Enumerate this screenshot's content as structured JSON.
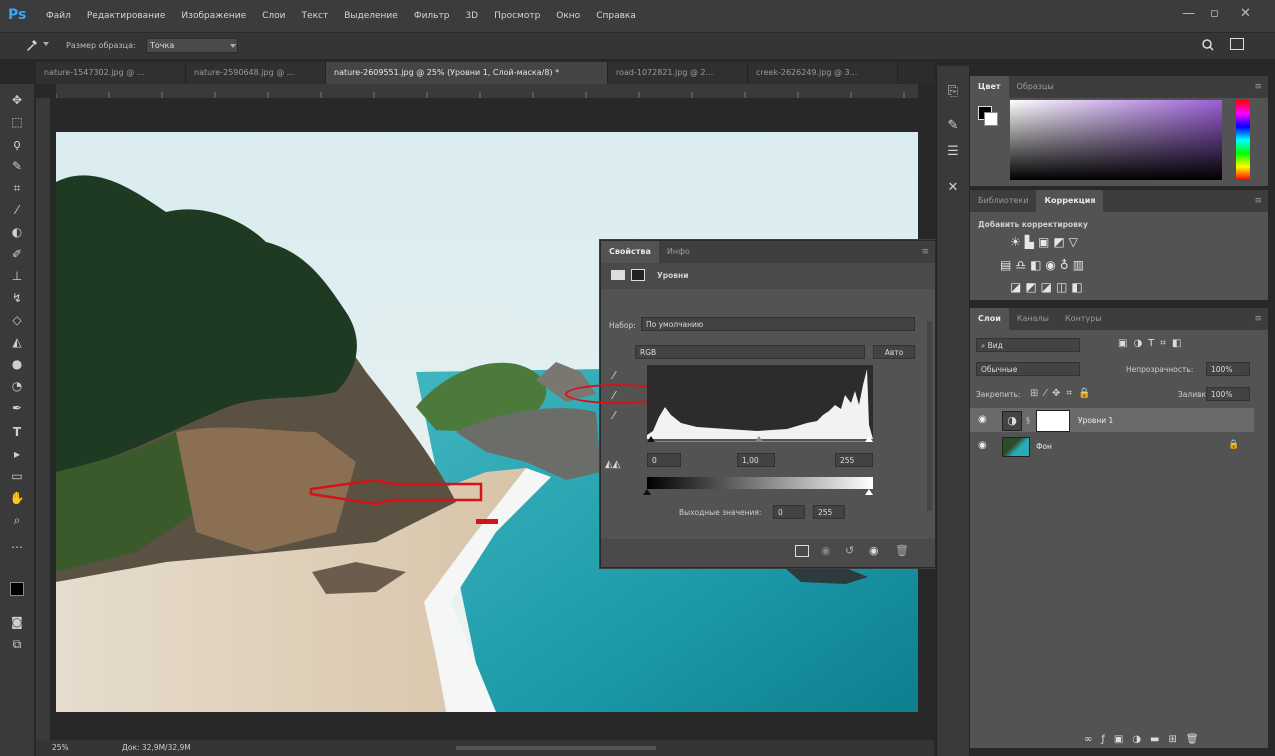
{
  "app": {
    "logo": "Ps",
    "menu": [
      "Файл",
      "Редактирование",
      "Изображение",
      "Слои",
      "Текст",
      "Выделение",
      "Фильтр",
      "3D",
      "Просмотр",
      "Окно",
      "Справка"
    ],
    "window_controls": [
      "—",
      "▫",
      "✕"
    ]
  },
  "options": {
    "tool_icon": "eyedropper-icon",
    "sample_label": "Размер образца:",
    "sample_value": "Точка"
  },
  "tabs": [
    {
      "label": "nature-1547302.jpg @ ...",
      "close": "×"
    },
    {
      "label": "nature-2590648.jpg @ ...",
      "close": "×"
    },
    {
      "label": "nature-2609551.jpg @ 25% (Уровни 1, Слой-маска/8) *",
      "close": "×"
    },
    {
      "label": "road-1072821.jpg @ 2...",
      "close": "×"
    },
    {
      "label": "creek-2626249.jpg @ 3...",
      "close": "×"
    }
  ],
  "ruler": {
    "h_ticks": [
      "",
      "1",
      "2",
      "3",
      "4",
      "5",
      "10",
      "11",
      "12",
      "13",
      "14",
      "15",
      "16",
      "17",
      "18",
      "19",
      "20",
      "21",
      "22",
      "23",
      "24",
      "25",
      "26",
      "27",
      "28",
      "29",
      "30",
      "31",
      "32",
      "33"
    ]
  },
  "status": {
    "zoom": "25%",
    "doc": "Док: 32,9M/32,9M"
  },
  "color_panel": {
    "tabs": [
      "Цвет",
      "Образцы"
    ],
    "colors": {
      "field_top": "#a37ad4",
      "foreground": "#000000",
      "background": "#ffffff"
    }
  },
  "adjustments_panel": {
    "tabs": [
      "Библиотеки",
      "Коррекция"
    ],
    "title": "Добавить корректировку"
  },
  "layers_panel": {
    "tabs": [
      "Слои",
      "Каналы",
      "Контуры"
    ],
    "kind": "Вид",
    "blend": "Обычные",
    "opacity_label": "Непрозрачность:",
    "opacity": "100%",
    "lock_label": "Закрепить:",
    "fill_label": "Заливка:",
    "fill": "100%",
    "layers": [
      {
        "name": "Уровни 1",
        "type": "adjustment"
      },
      {
        "name": "Фон",
        "type": "image"
      }
    ]
  },
  "properties": {
    "tabs": [
      "Свойства",
      "Инфо"
    ],
    "title": "Уровни",
    "preset_label": "Набор:",
    "preset": "По умолчанию",
    "channel": "RGB",
    "auto": "Авто",
    "input": [
      "0",
      "1,00",
      "255"
    ],
    "output_label": "Выходные значения:",
    "output": [
      "0",
      "255"
    ]
  },
  "accent": {
    "annotation_red": "#d4121a",
    "workspace": "#282828",
    "panel": "#535353"
  }
}
